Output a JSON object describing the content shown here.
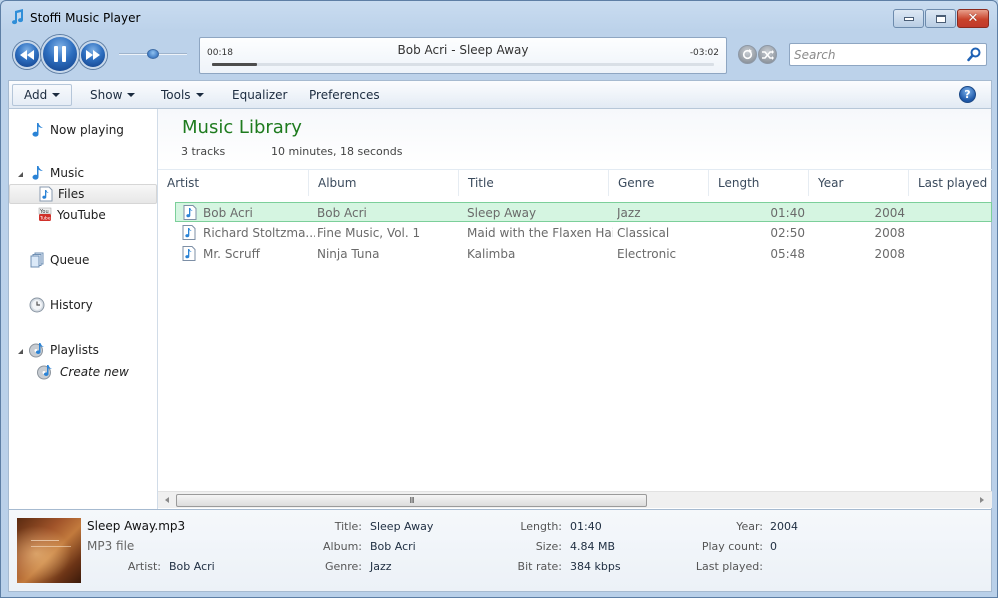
{
  "window": {
    "title": "Stoffi Music Player",
    "controls": {
      "minimize": "minimize",
      "maximize": "maximize",
      "close": "close"
    }
  },
  "player": {
    "now_playing": "Bob Acri - Sleep Away",
    "elapsed": "00:18",
    "remaining": "-03:02",
    "progress_fraction": 0.09,
    "volume_fraction": 0.5,
    "state": "playing",
    "icons": {
      "previous": "previous-icon",
      "pause": "pause-icon",
      "next": "next-icon",
      "repeat": "repeat-icon",
      "shuffle": "shuffle-icon"
    }
  },
  "search": {
    "placeholder": "Search",
    "value": ""
  },
  "toolbar": {
    "items": [
      {
        "label": "Add",
        "dropdown": true,
        "active": true
      },
      {
        "label": "Show",
        "dropdown": true
      },
      {
        "label": "Tools",
        "dropdown": true
      },
      {
        "label": "Equalizer",
        "dropdown": false
      },
      {
        "label": "Preferences",
        "dropdown": false
      }
    ],
    "help_label": "?"
  },
  "sidebar": {
    "items": [
      {
        "label": "Now playing",
        "icon": "music-note-icon"
      },
      {
        "label": "Music",
        "icon": "music-note-icon",
        "expanded": true
      },
      {
        "label": "Files",
        "icon": "audio-file-icon",
        "selected": true
      },
      {
        "label": "YouTube",
        "icon": "youtube-icon"
      },
      {
        "label": "Queue",
        "icon": "queue-icon"
      },
      {
        "label": "History",
        "icon": "clock-icon"
      },
      {
        "label": "Playlists",
        "icon": "playlist-icon",
        "expanded": true
      },
      {
        "label": "Create new",
        "icon": "playlist-icon"
      }
    ]
  },
  "library": {
    "title": "Music Library",
    "track_count": "3 tracks",
    "total_duration": "10 minutes, 18 seconds",
    "columns": [
      "Artist",
      "Album",
      "Title",
      "Genre",
      "Length",
      "Year",
      "Last played"
    ],
    "rows": [
      {
        "artist": "Bob Acri",
        "album": "Bob Acri",
        "title": "Sleep Away",
        "genre": "Jazz",
        "length": "01:40",
        "year": "2004",
        "last_played": "",
        "selected": true
      },
      {
        "artist": "Richard Stoltzma...",
        "album": "Fine Music, Vol. 1",
        "title": "Maid with the Flaxen Hair",
        "genre": "Classical",
        "length": "02:50",
        "year": "2008",
        "last_played": ""
      },
      {
        "artist": "Mr. Scruff",
        "album": "Ninja Tuna",
        "title": "Kalimba",
        "genre": "Electronic",
        "length": "05:48",
        "year": "2008",
        "last_played": ""
      }
    ],
    "scrollbar_grip": "III"
  },
  "details": {
    "filename": "Sleep Away.mp3",
    "filetype": "MP3 file",
    "fields": {
      "artist": {
        "label": "Artist:",
        "value": "Bob Acri"
      },
      "title": {
        "label": "Title:",
        "value": "Sleep Away"
      },
      "album": {
        "label": "Album:",
        "value": "Bob Acri"
      },
      "genre": {
        "label": "Genre:",
        "value": "Jazz"
      },
      "length": {
        "label": "Length:",
        "value": "01:40"
      },
      "size": {
        "label": "Size:",
        "value": "4.84 MB"
      },
      "bitrate": {
        "label": "Bit rate:",
        "value": "384 kbps"
      },
      "year": {
        "label": "Year:",
        "value": "2004"
      },
      "play_count": {
        "label": "Play count:",
        "value": "0"
      },
      "last_played": {
        "label": "Last played:",
        "value": ""
      }
    }
  }
}
